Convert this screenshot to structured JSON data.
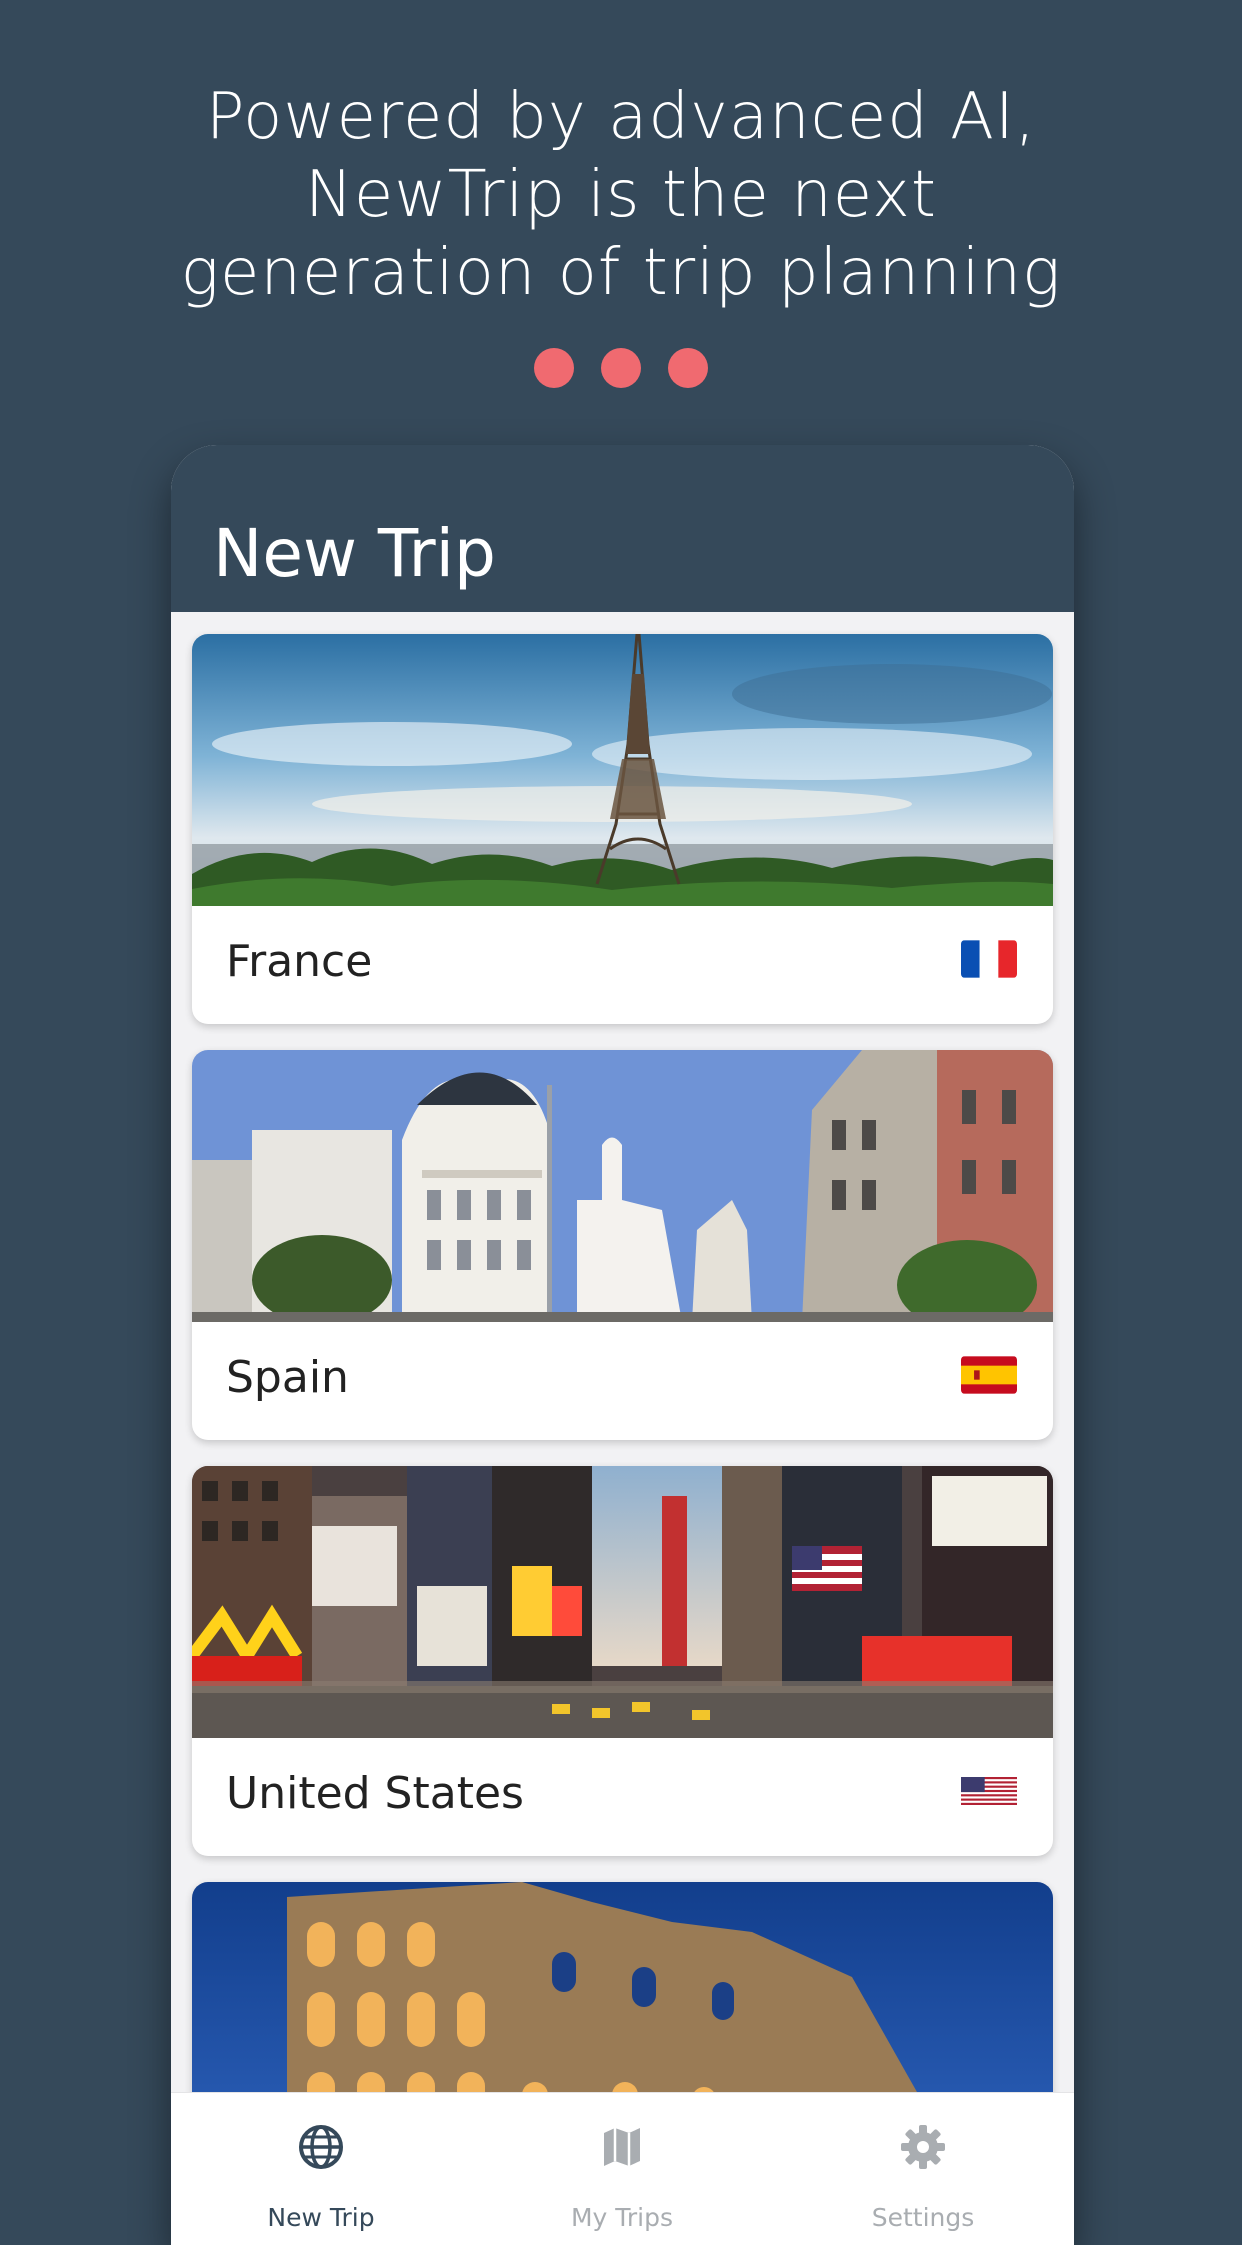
{
  "headline": {
    "line1": "Powered by advanced AI,",
    "line2": "NewTrip is the next",
    "line3": "generation of trip planning"
  },
  "accent_color": "#f06a70",
  "background_color": "#35495a",
  "app": {
    "title": "New Trip",
    "destinations": [
      {
        "name": "France",
        "flag": "flag-france-icon"
      },
      {
        "name": "Spain",
        "flag": "flag-spain-icon"
      },
      {
        "name": "United States",
        "flag": "flag-usa-icon"
      },
      {
        "name": "",
        "flag": ""
      }
    ],
    "tabs": [
      {
        "label": "New Trip",
        "icon": "globe-icon",
        "active": true
      },
      {
        "label": "My Trips",
        "icon": "map-icon",
        "active": false
      },
      {
        "label": "Settings",
        "icon": "gear-icon",
        "active": false
      }
    ]
  }
}
